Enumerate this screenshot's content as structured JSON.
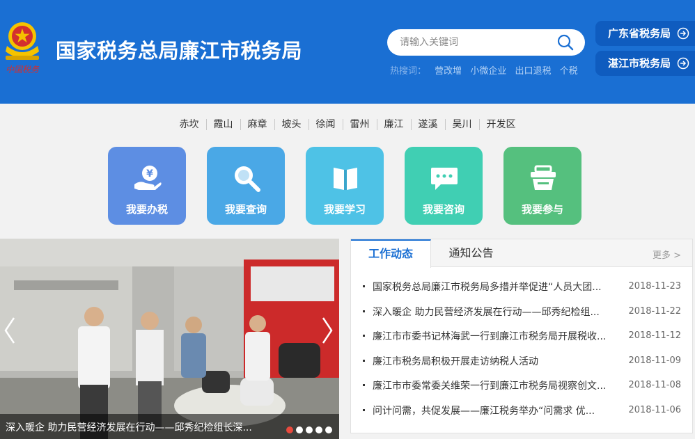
{
  "header": {
    "title": "国家税务总局廉江市税务局",
    "emblem_text": "中国税务",
    "search": {
      "placeholder": "请输入关键词"
    },
    "hot": {
      "label": "热搜词：",
      "words": [
        "营改增",
        "小微企业",
        "出口退税",
        "个税"
      ]
    },
    "links": [
      "广东省税务局",
      "湛江市税务局"
    ]
  },
  "regions": [
    "赤坎",
    "霞山",
    "麻章",
    "坡头",
    "徐闻",
    "雷州",
    "廉江",
    "遂溪",
    "吴川",
    "开发区"
  ],
  "tiles": [
    {
      "label": "我要办税",
      "icon": "hand-yuan-icon",
      "color": "#5d8ee3"
    },
    {
      "label": "我要查询",
      "icon": "magnifier-icon",
      "color": "#4aa8e6"
    },
    {
      "label": "我要学习",
      "icon": "book-icon",
      "color": "#4ec2e6"
    },
    {
      "label": "我要咨询",
      "icon": "chat-bubble-icon",
      "color": "#40cfb3"
    },
    {
      "label": "我要参与",
      "icon": "basket-icon",
      "color": "#55c07e"
    }
  ],
  "slider": {
    "caption": "深入暖企 助力民营经济发展在行动——邱秀纪检组长深...",
    "dot_count": 5,
    "active_dot": 0
  },
  "news": {
    "tabs": [
      "工作动态",
      "通知公告"
    ],
    "active_tab": 0,
    "more": "更多 >",
    "items": [
      {
        "title": "国家税务总局廉江市税务局多措并举促进“人员大团...",
        "date": "2018-11-23"
      },
      {
        "title": "深入暖企 助力民营经济发展在行动——邱秀纪检组...",
        "date": "2018-11-22"
      },
      {
        "title": "廉江市市委书记林海武一行到廉江市税务局开展税收...",
        "date": "2018-11-12"
      },
      {
        "title": "廉江市税务局积极开展走访纳税人活动",
        "date": "2018-11-09"
      },
      {
        "title": "廉江市市委常委关维荣一行到廉江市税务局视察创文...",
        "date": "2018-11-08"
      },
      {
        "title": "问计问需，共促发展——廉江税务举办“问需求 优...",
        "date": "2018-11-06"
      }
    ]
  },
  "colors": {
    "header_bg": "#1a6fd3",
    "accent": "#1a6fd3",
    "active_dot": "#e94a3e"
  }
}
